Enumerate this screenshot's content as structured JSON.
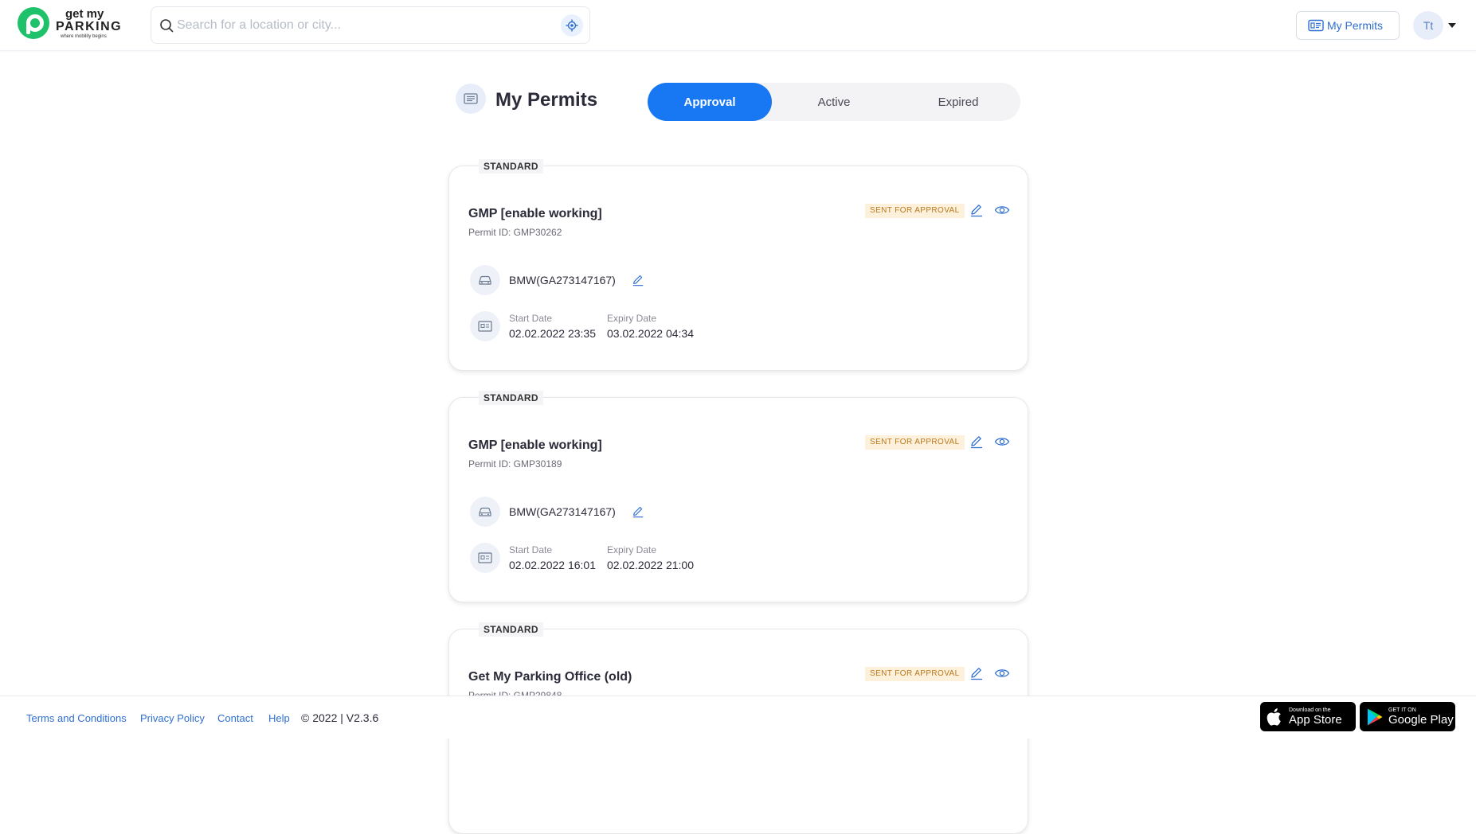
{
  "header": {
    "logo": {
      "line1": "get my",
      "line2": "PARKING",
      "tagline": "where mobility begins"
    },
    "search": {
      "placeholder": "Search for a location or city...",
      "value": ""
    },
    "permits_button": "My Permits",
    "avatar_initials": "Tt"
  },
  "page": {
    "title": "My Permits",
    "tabs": [
      {
        "label": "Approval",
        "active": true
      },
      {
        "label": "Active",
        "active": false
      },
      {
        "label": "Expired",
        "active": false
      }
    ]
  },
  "permits": [
    {
      "type": "STANDARD",
      "name": "GMP [enable working]",
      "permit_id": "Permit ID: GMP30262",
      "status": "SENT FOR APPROVAL",
      "vehicle": "BMW(GA273147167)",
      "start_label": "Start Date",
      "start_value": "02.02.2022 23:35",
      "expiry_label": "Expiry Date",
      "expiry_value": "03.02.2022 04:34"
    },
    {
      "type": "STANDARD",
      "name": "GMP [enable working]",
      "permit_id": "Permit ID: GMP30189",
      "status": "SENT FOR APPROVAL",
      "vehicle": "BMW(GA273147167)",
      "start_label": "Start Date",
      "start_value": "02.02.2022 16:01",
      "expiry_label": "Expiry Date",
      "expiry_value": "02.02.2022 21:00"
    },
    {
      "type": "STANDARD",
      "name": "Get My Parking Office (old)",
      "permit_id": "Permit ID: GMP29848",
      "status": "SENT FOR APPROVAL"
    }
  ],
  "footer": {
    "links": [
      "Terms and Conditions",
      "Privacy Policy",
      "Contact",
      "Help"
    ],
    "copyright": "© 2022 | V2.3.6",
    "app_store": {
      "small": "Download on the",
      "big": "App Store"
    },
    "google_play": {
      "small": "GET IT ON",
      "big": "Google Play"
    }
  },
  "colors": {
    "accent": "#1877f2",
    "brand_green": "#1fc16b",
    "status_bg": "#fdf1dc",
    "status_text": "#b9781c"
  }
}
